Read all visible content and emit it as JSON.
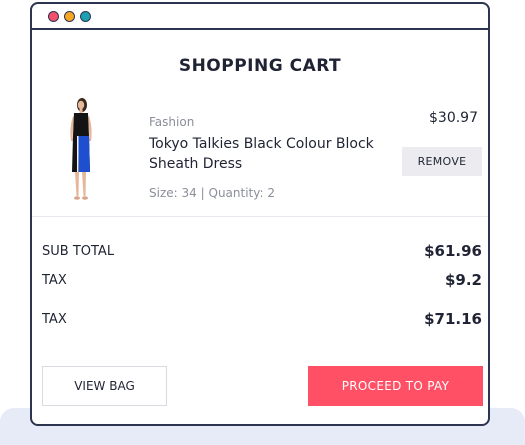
{
  "cart": {
    "title": "SHOPPING CART"
  },
  "product": {
    "category": "Fashion",
    "name": "Tokyo Talkies Black Colour Block Sheath Dress",
    "size_label": "Size:",
    "size_value": "34",
    "separator": "|",
    "quantity_label": "Quantity:",
    "quantity_value": "2",
    "price": "$30.97",
    "remove_label": "REMOVE",
    "image_icon": "dress-model-image"
  },
  "summary": {
    "subtotal_label": "SUB TOTAL",
    "subtotal_value": "$61.96",
    "tax_label": "TAX",
    "tax_value": "$9.2",
    "total_label": "TAX",
    "total_value": "$71.16"
  },
  "actions": {
    "view_bag_label": "VIEW BAG",
    "proceed_label": "PROCEED TO PAY"
  },
  "colors": {
    "accent": "#ff5066",
    "window_border": "#2d3450",
    "dot_red": "#f1506a",
    "dot_yellow": "#f6a623",
    "dot_teal": "#1c9fb1",
    "dress_blue": "#1f4fd1"
  }
}
